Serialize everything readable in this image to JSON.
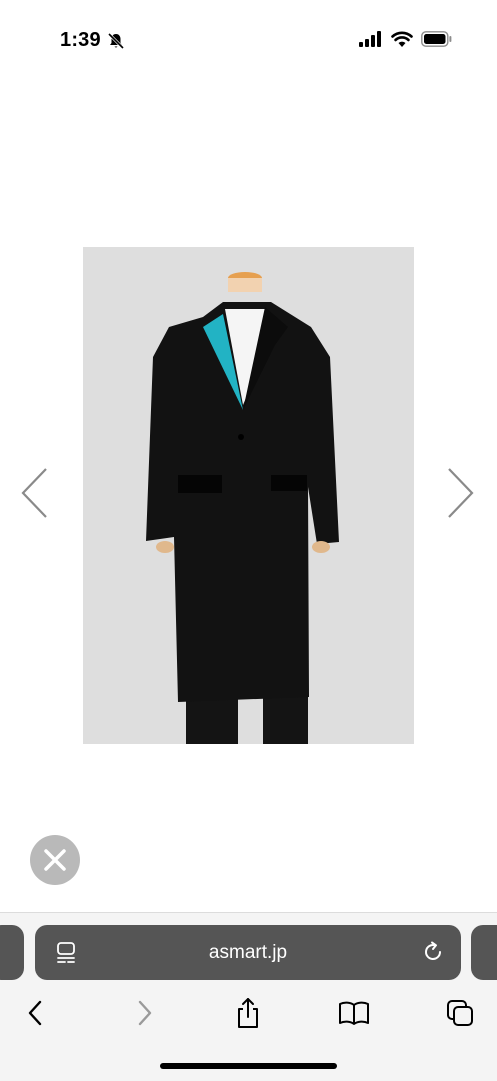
{
  "status_bar": {
    "time": "1:39",
    "icons": [
      "bell-slash-icon",
      "cellular-signal-icon",
      "wifi-icon",
      "battery-icon"
    ]
  },
  "gallery": {
    "image_alt": "",
    "prev_icon": "chevron-left-icon",
    "next_icon": "chevron-right-icon",
    "close_icon": "close-icon",
    "colors": {
      "backdrop": "#dedede",
      "coat": "#111111",
      "lapel_accent": "#22b3c4"
    }
  },
  "safari": {
    "url": "asmart.jp",
    "address_bar_color": "#555555",
    "toolbar_icons": [
      "back-icon",
      "forward-icon",
      "share-icon",
      "bookmarks-icon",
      "tabs-icon"
    ]
  }
}
